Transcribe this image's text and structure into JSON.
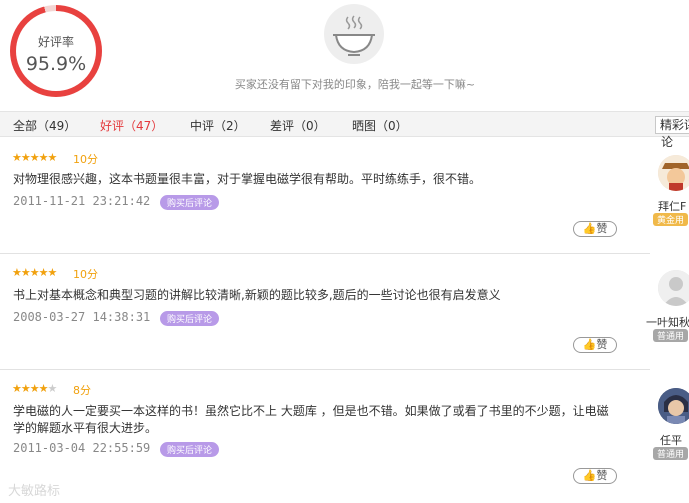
{
  "summary": {
    "rating_label": "好评率",
    "rating_value": "95.9%",
    "rating_fraction": 0.959,
    "empty_message": "买家还没有留下对我的印象，陪我一起等一下嘛~"
  },
  "tabs": [
    {
      "label": "全部（49）"
    },
    {
      "label": "好评（47）"
    },
    {
      "label": "中评（2）"
    },
    {
      "label": "差评（0）"
    },
    {
      "label": "晒图（0）"
    }
  ],
  "sort_label": "精彩评",
  "sort_label_wrap": "论",
  "reviews": [
    {
      "stars": "★★★★★",
      "stars_off": "",
      "score": "10分",
      "content": "对物理很感兴趣，这本书题量很丰富，对于掌握电磁学很有帮助。平时练练手，很不错。",
      "date": "2011-11-21 23:21:42",
      "tag": "购买后评论",
      "like": "赞",
      "user_name": "拜仁F",
      "user_badge": "黄金用"
    },
    {
      "stars": "★★★★★",
      "stars_off": "",
      "score": "10分",
      "content": "书上对基本概念和典型习题的讲解比较清晰,新颖的题比较多,题后的一些讨论也很有启发意义",
      "date": "2008-03-27 14:38:31",
      "tag": "购买后评论",
      "like": "赞",
      "user_name": "一叶知秋",
      "user_badge": "普通用"
    },
    {
      "stars": "★★★★",
      "stars_off": "★",
      "score": "8分",
      "content": "学电磁的人一定要买一本这样的书！虽然它比不上 大题库 ，但是也不错。如果做了或看了书里的不少题，让电磁学的解题水平有很大进步。",
      "date": "2011-03-04 22:55:59",
      "tag": "购买后评论",
      "like": "赞",
      "user_name": "任平",
      "user_badge": "普通用"
    }
  ],
  "colors": {
    "accent": "#e4393c",
    "star": "#f1a10e",
    "tag": "#b89ae8",
    "badge_gold": "#f0b94a",
    "badge_normal": "#a7a7a7"
  },
  "watermark": "大敏路标"
}
